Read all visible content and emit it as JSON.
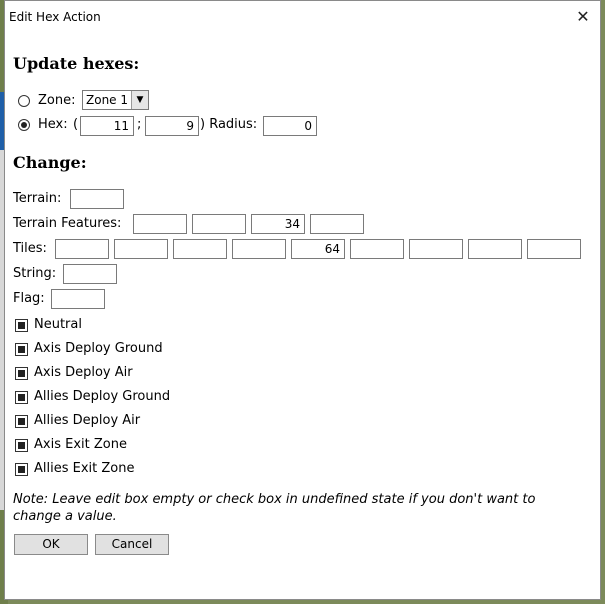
{
  "window": {
    "title": "Edit Hex Action",
    "close_glyph": "✕"
  },
  "update": {
    "heading": "Update hexes:",
    "zone_label": "Zone:",
    "zone_value": "Zone 1",
    "hex_label": "Hex:",
    "hex_open": "(",
    "hex_x": "11",
    "hex_sep": ";",
    "hex_y": "9",
    "radius_label": ") Radius:",
    "radius": "0"
  },
  "change": {
    "heading": "Change:",
    "terrain_label": "Terrain:",
    "features_label": "Terrain Features:",
    "features": [
      "",
      "",
      "34",
      ""
    ],
    "tiles_label": "Tiles:",
    "tiles": [
      "",
      "",
      "",
      "",
      "64",
      "",
      "",
      "",
      ""
    ],
    "string_label": "String:",
    "flag_label": "Flag:"
  },
  "checkboxes": [
    "Neutral",
    "Axis Deploy Ground",
    "Axis Deploy Air",
    "Allies Deploy Ground",
    "Allies Deploy Air",
    "Axis Exit Zone",
    "Allies Exit Zone"
  ],
  "note": "Note: Leave edit box empty or check box in undefined state if you don't want to change a value.",
  "buttons": {
    "ok": "OK",
    "cancel": "Cancel"
  },
  "icons": {
    "close": "close-icon",
    "dropdown": "chevron-down-icon"
  },
  "colors": {
    "background_map": "#7c8a5a",
    "accent_blue": "#1f5fa8"
  }
}
